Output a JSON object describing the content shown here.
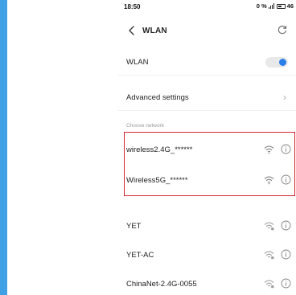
{
  "status_bar": {
    "time": "18:50",
    "data_speed": "0 %",
    "battery": "46"
  },
  "header": {
    "title": "WLAN"
  },
  "wlan_row": {
    "label": "WLAN",
    "enabled": true
  },
  "advanced_row": {
    "label": "Advanced settings"
  },
  "section": {
    "choose_network_label": "Choose network"
  },
  "networks": [
    {
      "name": "wireless2.4G_******",
      "signal": "full",
      "highlighted": true
    },
    {
      "name": "Wireless5G_******",
      "signal": "full",
      "highlighted": true
    },
    {
      "name": "YET",
      "signal": "locked",
      "highlighted": false
    },
    {
      "name": "YET-AC",
      "signal": "locked",
      "highlighted": false
    },
    {
      "name": "ChinaNet-2.4G-0055",
      "signal": "locked",
      "highlighted": false
    }
  ],
  "colors": {
    "accent_blue": "#2a7fe8",
    "highlight_red": "#d9232d",
    "side_bar": "#3fa0e6"
  },
  "icons": {
    "back": "back-arrow-icon",
    "refresh": "refresh-icon",
    "wifi": "wifi-icon",
    "info": "info-icon",
    "chevron": "chevron-right-icon"
  }
}
